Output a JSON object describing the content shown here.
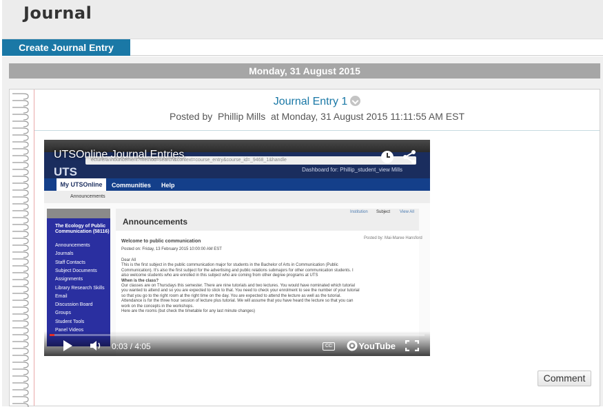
{
  "page": {
    "title": "Journal"
  },
  "actions": {
    "create_label": "Create Journal Entry"
  },
  "date_bar": {
    "label": "Monday, 31 August 2015"
  },
  "entry": {
    "title": "Journal Entry 1",
    "posted_by_prefix": "Posted by",
    "author": "Phillip Mills",
    "posted_at": "at Monday, 31 August 2015 11:11:55 AM EST",
    "comment_label": "Comment"
  },
  "video": {
    "title": "UTSOnline Journal Entries",
    "time": "0:03 / 4:05",
    "progress": 0.012,
    "player_brand": "YouTube",
    "cc_label": "CC",
    "embedded": {
      "logo": "UTS",
      "dashboard": "Dashboard for: Phillip_student_view Mills",
      "nav_active": "My UTSOnline",
      "nav_items": [
        "Communities",
        "Help"
      ],
      "crumb": "Announcements",
      "subject": "The Ecology of Public Communication (58116)",
      "side_items": [
        "Announcements",
        "Journals",
        "Staff Contacts",
        "Subject Documents",
        "Assignments",
        "Library Research Skills",
        "Email",
        "Discussion Board",
        "Groups",
        "Student Tools",
        "Panel Videos"
      ],
      "tabs": [
        "Institution",
        "Subject",
        "View All"
      ],
      "heading": "Announcements",
      "post_title": "Welcome to public communication",
      "post_date": "Posted on: Friday, 13 February 2015 10:00:00 AM EST",
      "post_lines": [
        "Dear All",
        "This is the first subject in the public communication major for students in the Bachelor of Arts in Communication (Public",
        "Communication). It's also the first subject for the advertising and public relations submajors for other communication students. I",
        "also welcome students who are enrolled in this subject who are coming from other degree programs at UTS",
        "When is the class?",
        "Our classes are on Thursdays this semester. There are nine tutorials and two lectures. You would have nominated which tutorial",
        "you wanted to attend and so you are expected to stick to that. You need to check your enrolment to see the number of your tutorial",
        "so that you go to the right room at the right time on the day. You are expected to attend the lecture as well as the tutorial.",
        "Attendance is for the three hour session of lecture plus tutorial. We will assume that you have heard the lecture so that you can",
        "work on the concepts in the workshops.",
        "Here are the rooms (but check the timetable for any last minute changes)"
      ],
      "posted_by": "Posted by: Mai-Maree Hansford"
    }
  },
  "colors": {
    "accent": "#1a78a6",
    "date_bar": "#a6a6a6",
    "youtube_red": "#e52d27"
  }
}
